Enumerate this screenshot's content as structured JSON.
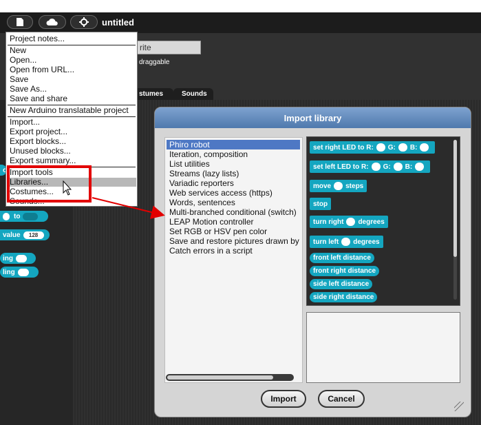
{
  "app": {
    "title": "untitled"
  },
  "toolbar": {
    "file_icon": "file-icon",
    "cloud_icon": "cloud-icon",
    "settings_icon": "gear-icon"
  },
  "sprite": {
    "name": "rite",
    "draggable_label": "draggable"
  },
  "tabs": [
    {
      "label": "stumes"
    },
    {
      "label": "Sounds"
    }
  ],
  "palette": {
    "blocks": [
      {
        "label": "o"
      },
      {
        "label": "to"
      },
      {
        "label": "value",
        "value": "128"
      },
      {
        "label": "ing"
      },
      {
        "label": "ling"
      }
    ]
  },
  "file_menu": {
    "items": [
      {
        "label": "Project notes..."
      },
      {
        "label": "New"
      },
      {
        "label": "Open..."
      },
      {
        "label": "Open from URL..."
      },
      {
        "label": "Save"
      },
      {
        "label": "Save As..."
      },
      {
        "label": "Save and share"
      },
      {
        "label": "New Arduino translatable project"
      },
      {
        "label": "Import..."
      },
      {
        "label": "Export project..."
      },
      {
        "label": "Export blocks..."
      },
      {
        "label": "Unused blocks..."
      },
      {
        "label": "Export summary..."
      },
      {
        "label": "Import tools"
      },
      {
        "label": "Libraries..."
      },
      {
        "label": "Costumes..."
      },
      {
        "label": "Sounds..."
      }
    ],
    "highlighted": "Libraries..."
  },
  "dialog": {
    "title": "Import library",
    "libraries": [
      "Phiro robot",
      "Iteration, composition",
      "List utilities",
      "Streams (lazy lists)",
      "Variadic reporters",
      "Web services access (https)",
      "Words, sentences",
      "Multi-branched conditional (switch)",
      "LEAP Motion controller",
      "Set RGB or HSV pen color",
      "Save and restore pictures drawn by",
      "Catch errors in a script"
    ],
    "selected": "Phiro robot",
    "blocks": {
      "set_right_led": {
        "a": "set right LED to R:",
        "b": "G:",
        "c": "B:"
      },
      "set_left_led": {
        "a": "set left LED to R:",
        "b": "G:",
        "c": "B:"
      },
      "move": {
        "a": "move",
        "b": "steps"
      },
      "stop": "stop",
      "turn_right": {
        "a": "turn right",
        "b": "degrees"
      },
      "turn_left": {
        "a": "turn left",
        "b": "degrees"
      },
      "reporters": [
        "front left distance",
        "front right distance",
        "side left distance",
        "side right distance"
      ]
    },
    "buttons": {
      "import": "Import",
      "cancel": "Cancel"
    }
  },
  "colors": {
    "block": "#14a6c0",
    "selection": "#4e78c4",
    "callout": "#e20000",
    "title_bar": "#5b83b6"
  }
}
